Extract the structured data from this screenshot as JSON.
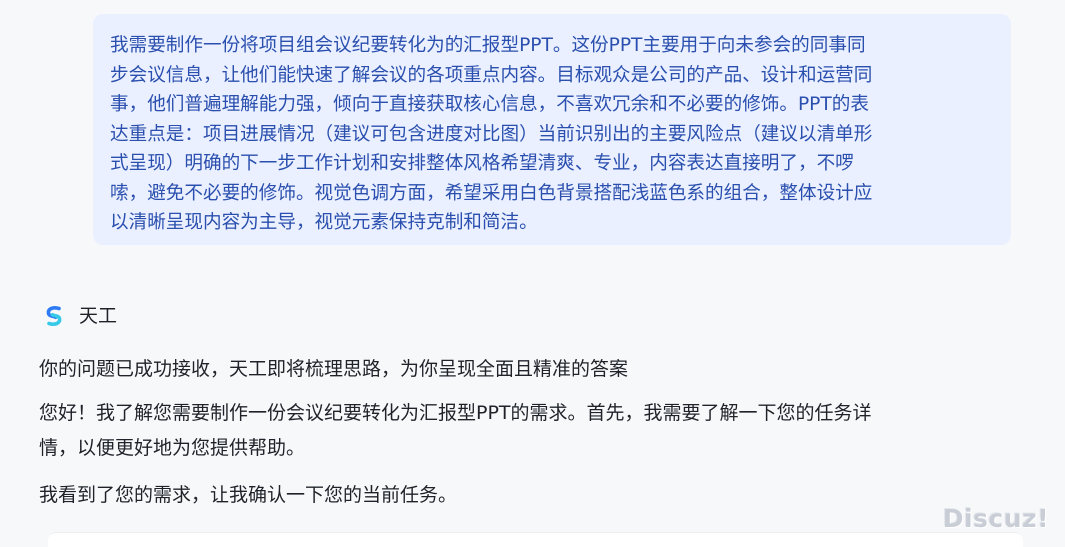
{
  "user_message": {
    "text": "我需要制作一份将项目组会议纪要转化为的汇报型PPT。这份PPT主要用于向未参会的同事同\n步会议信息，让他们能快速了解会议的各项重点内容。目标观众是公司的产品、设计和运营同\n事，他们普遍理解能力强，倾向于直接获取核心信息，不喜欢冗余和不必要的修饰。PPT的表\n达重点是：项目进展情况（建议可包含进度对比图）当前识别出的主要风险点（建议以清单形\n式呈现）明确的下一步工作计划和安排整体风格希望清爽、专业，内容表达直接明了，不啰\n嗦，避免不必要的修饰。视觉色调方面，希望采用白色背景搭配浅蓝色系的组合，整体设计应\n以清晰呈现内容为主导，视觉元素保持克制和简洁。"
  },
  "assistant": {
    "name": "天工",
    "logo_icon": "tiangong-logo-icon",
    "messages": [
      "你的问题已成功接收，天工即将梳理思路，为你呈现全面且精准的答案",
      "您好！我了解您需要制作一份会议纪要转化为汇报型PPT的需求。首先，我需要了解一下您的任务详\n情，以便更好地为您提供帮助。",
      "我看到了您的需求，让我确认一下您的当前任务。"
    ]
  },
  "watermark": "Discuz!",
  "colors": {
    "page_background": "#f7f8fa",
    "user_bubble_background": "#eaf0ff",
    "user_text": "#2a4fae",
    "assistant_text": "#1f2329",
    "logo_blue": "#2f7bf5",
    "logo_cyan": "#36c9e8"
  }
}
